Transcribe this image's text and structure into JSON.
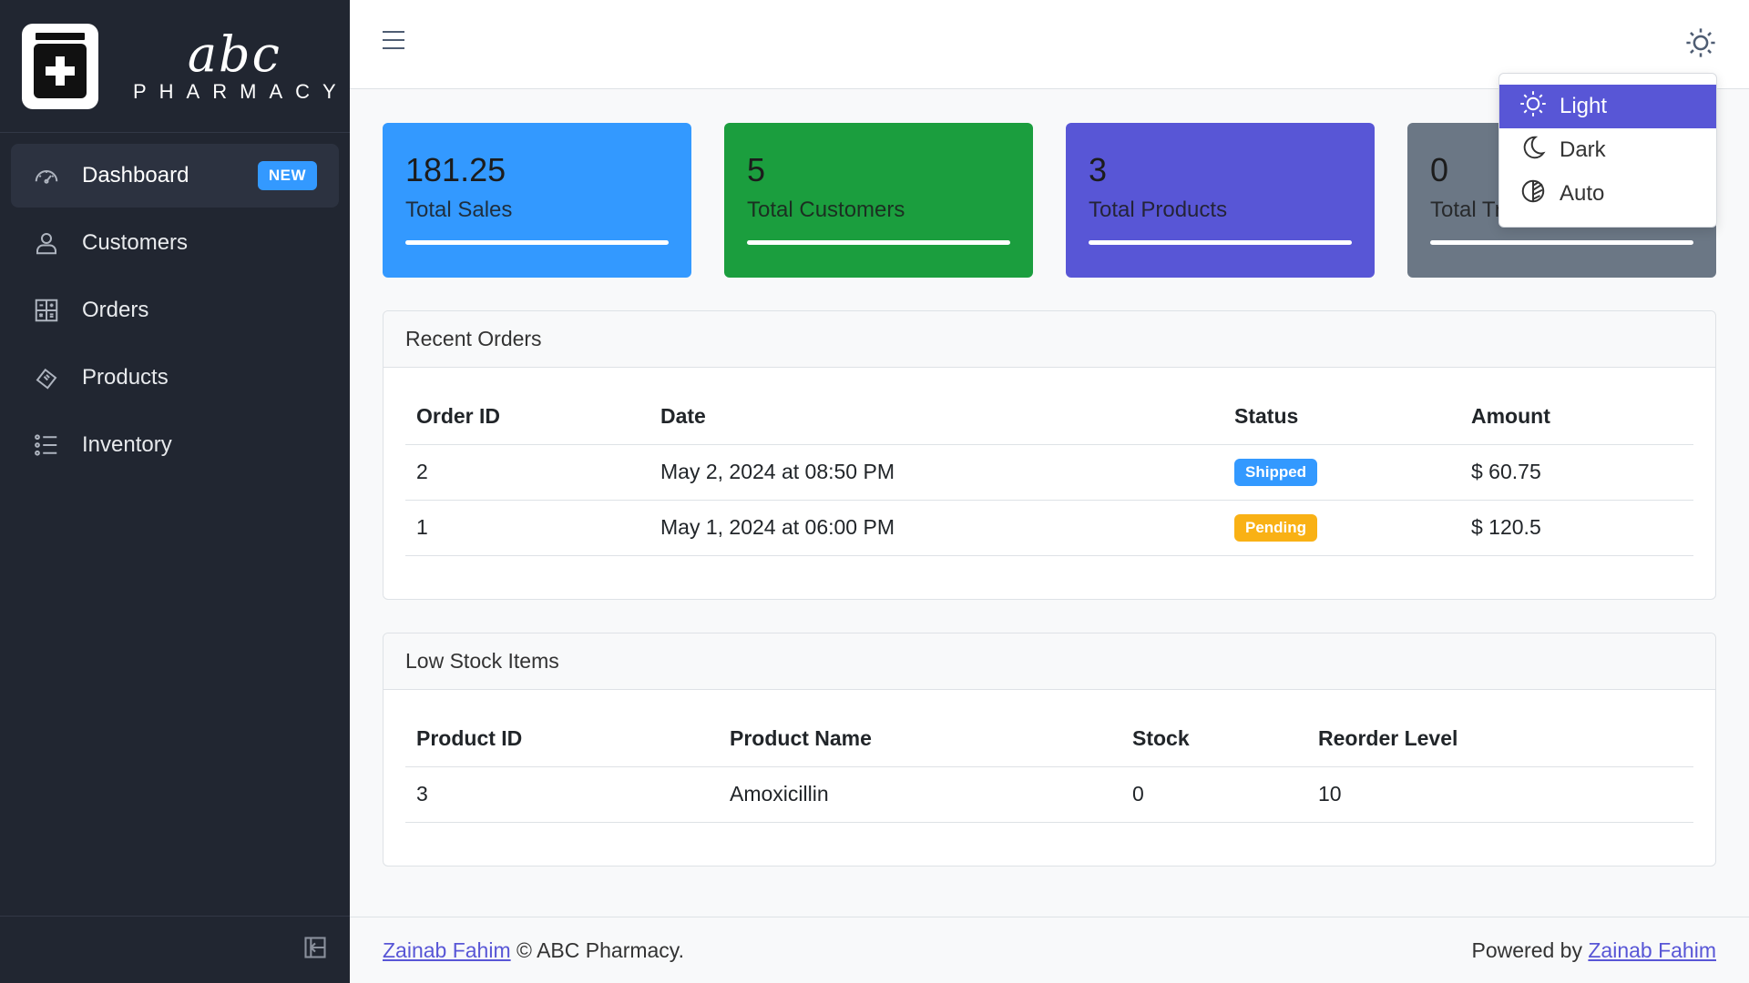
{
  "brand": {
    "logo_text": "abc",
    "name": "PHARMACY"
  },
  "sidebar": {
    "items": [
      {
        "label": "Dashboard",
        "icon": "speedometer-icon",
        "badge": "NEW",
        "active": true
      },
      {
        "label": "Customers",
        "icon": "user-icon"
      },
      {
        "label": "Orders",
        "icon": "calculator-icon"
      },
      {
        "label": "Products",
        "icon": "bandage-icon"
      },
      {
        "label": "Inventory",
        "icon": "list-icon"
      }
    ]
  },
  "theme_menu": {
    "items": [
      {
        "label": "Light",
        "icon": "sun-icon",
        "active": true
      },
      {
        "label": "Dark",
        "icon": "moon-icon"
      },
      {
        "label": "Auto",
        "icon": "contrast-icon"
      }
    ]
  },
  "stats": [
    {
      "value": "181.25",
      "label": "Total Sales",
      "color": "#3399ff"
    },
    {
      "value": "5",
      "label": "Total Customers",
      "color": "#1b9e3e"
    },
    {
      "value": "3",
      "label": "Total Products",
      "color": "#5856d6"
    },
    {
      "value": "0",
      "label": "Total Tr",
      "color": "#6b7785"
    }
  ],
  "recent_orders": {
    "title": "Recent Orders",
    "columns": [
      "Order ID",
      "Date",
      "Status",
      "Amount"
    ],
    "rows": [
      {
        "id": "2",
        "date": "May 2, 2024 at 08:50 PM",
        "status": "Shipped",
        "status_color": "#3399ff",
        "amount": "$ 60.75"
      },
      {
        "id": "1",
        "date": "May 1, 2024 at 06:00 PM",
        "status": "Pending",
        "status_color": "#f9b115",
        "amount": "$ 120.5"
      }
    ]
  },
  "low_stock": {
    "title": "Low Stock Items",
    "columns": [
      "Product ID",
      "Product Name",
      "Stock",
      "Reorder Level"
    ],
    "rows": [
      {
        "id": "3",
        "name": "Amoxicillin",
        "stock": "0",
        "reorder": "10"
      }
    ]
  },
  "footer": {
    "author_link": "Zainab Fahim",
    "copyright": "© ABC Pharmacy.",
    "powered_prefix": "Powered by",
    "powered_link": "Zainab Fahim"
  }
}
